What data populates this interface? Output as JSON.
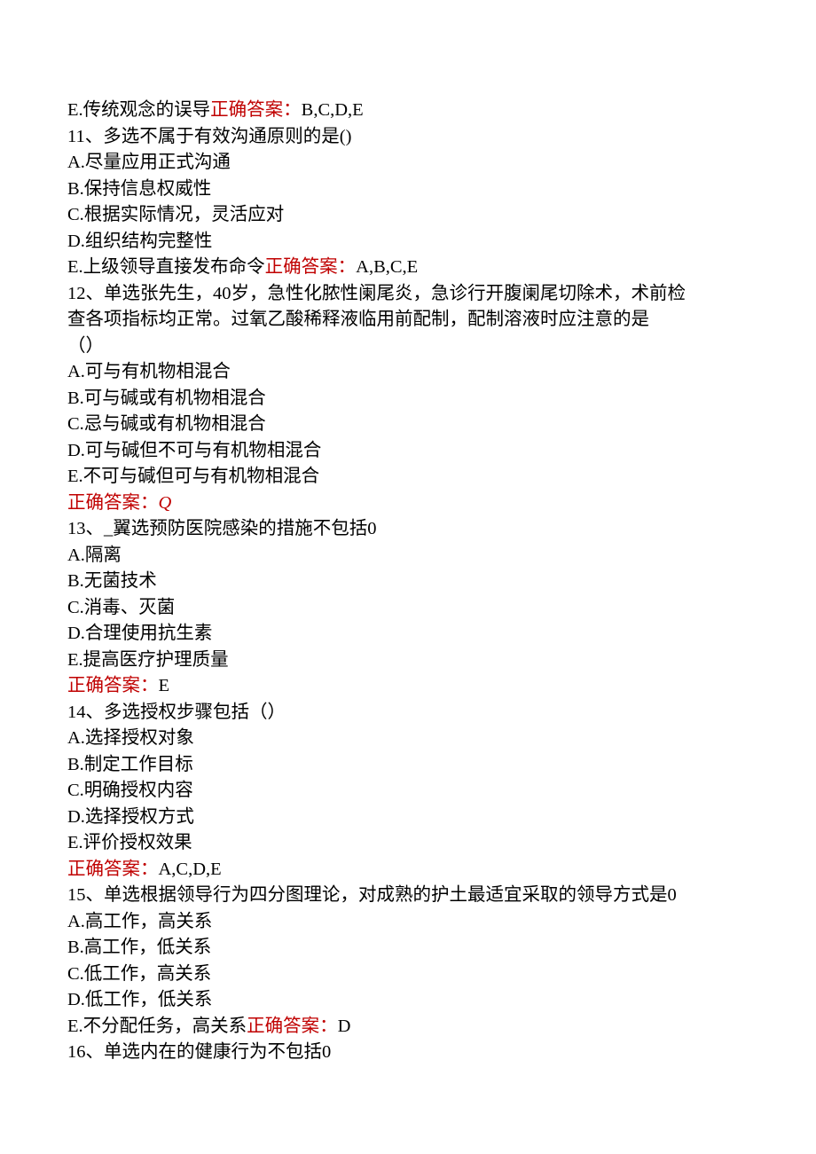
{
  "q10_tail": {
    "optE": "E.传统观念的误导",
    "ansLabel": "正确答案：",
    "ansVal": "B,C,D,E"
  },
  "q11": {
    "stem": "11、多选不属于有效沟通原则的是()",
    "optA": "A.尽量应用正式沟通",
    "optB": "B.保持信息权威性",
    "optC": "C.根据实际情况，灵活应对",
    "optD": "D.组织结构完整性",
    "optE": "E.上级领导直接发布命令",
    "ansLabel": "正确答案：",
    "ansVal": "A,B,C,E"
  },
  "q12": {
    "stem1": "12、单选张先生，40岁，急性化脓性阑尾炎，急诊行开腹阑尾切除术，术前检",
    "stem2": "查各项指标均正常。过氧乙酸稀释液临用前配制，配制溶液时应注意的是",
    "stem3": "（）",
    "optA": "A.可与有机物相混合",
    "optB": "B.可与碱或有机物相混合",
    "optC": "C.忌与碱或有机物相混合",
    "optD": "D.可与碱但不可与有机物相混合",
    "optE": "E.不可与碱但可与有机物相混合",
    "ansLabel": "正确答案：",
    "ansVal": "Q"
  },
  "q13": {
    "stem": "13、_翼选预防医院感染的措施不包括0",
    "optA": "A.隔离",
    "optB": "B.无菌技术",
    "optC": "C.消毒、灭菌",
    "optD": "D.合理使用抗生素",
    "optE": "E.提高医疗护理质量",
    "ansLabel": "正确答案：",
    "ansVal": "E"
  },
  "q14": {
    "stem": "14、多选授权步骤包括（）",
    "optA": "A.选择授权对象",
    "optB": "B.制定工作目标",
    "optC": "C.明确授权内容",
    "optD": "D.选择授权方式",
    "optE": "E.评价授权效果",
    "ansLabel": "正确答案：",
    "ansVal": "A,C,D,E"
  },
  "q15": {
    "stem": "15、单选根据领导行为四分图理论，对成熟的护土最适宜采取的领导方式是0",
    "optA": "A.高工作，高关系",
    "optB": "B.高工作，低关系",
    "optC": "C.低工作，高关系",
    "optD": "D.低工作，低关系",
    "optE": "E.不分配任务，高关系",
    "ansLabel": "正确答案：",
    "ansVal": "D"
  },
  "q16": {
    "stem": "16、单选内在的健康行为不包括0"
  }
}
